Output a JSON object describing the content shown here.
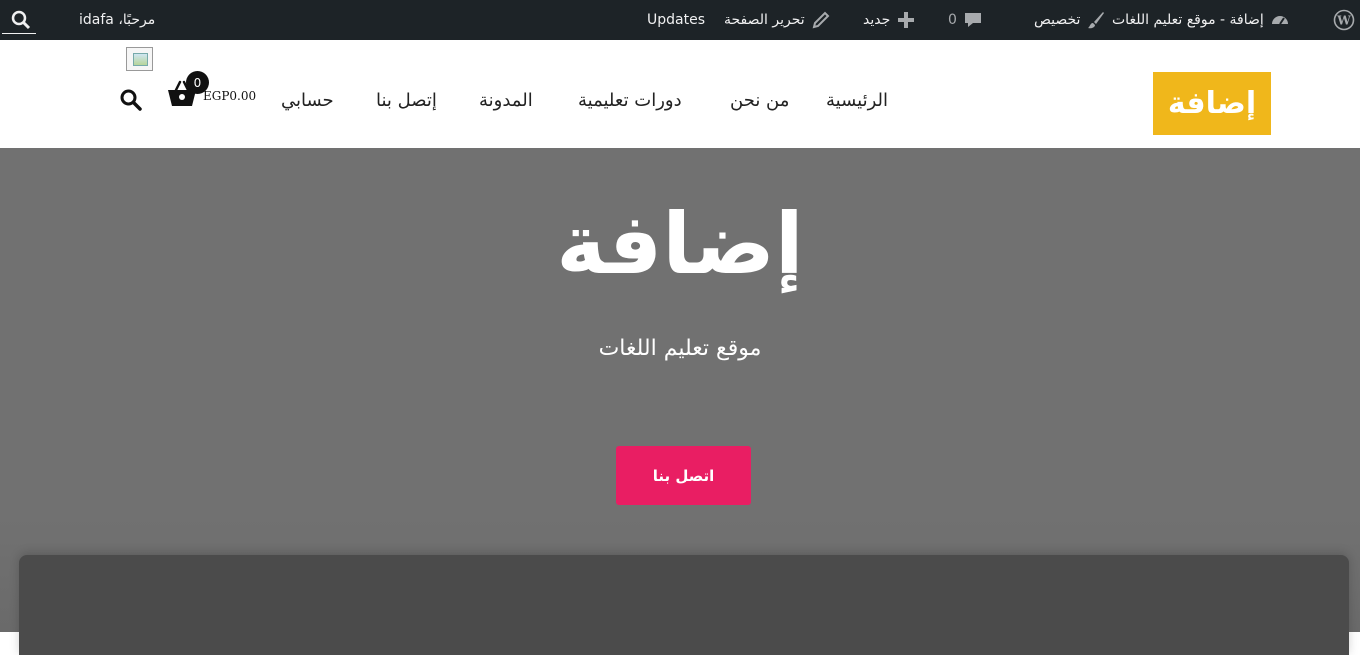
{
  "admin_bar": {
    "site_name": "إضافة - موقع تعليم اللغات",
    "customize": "تخصيص",
    "comments_count": "0",
    "new": "جديد",
    "edit_page": "تحرير الصفحة",
    "updates": "Updates",
    "greeting": "مرحبًا، idafa"
  },
  "header": {
    "logo_text": "إضافة",
    "logo_color": "#f0b71b",
    "nav": [
      "الرئيسية",
      "من نحن",
      "دورات تعليمية",
      "المدونة",
      "إتصل بنا",
      "حسابي"
    ],
    "cart_count": "0",
    "cart_total": "EGP0.00"
  },
  "hero": {
    "title": "إضافة",
    "subtitle": "موقع تعليم اللغات",
    "button": "اتصل بنا",
    "button_color": "#e91e63"
  }
}
